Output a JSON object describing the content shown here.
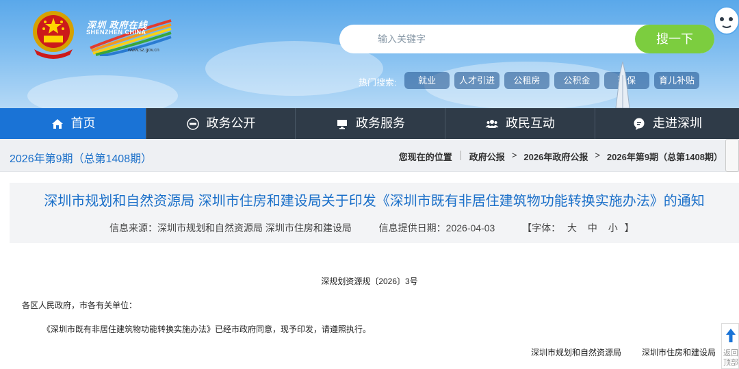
{
  "header": {
    "logo_cn": "深圳 政府在线",
    "logo_en": "SHENZHEN CHINA",
    "logo_url": "www.sz.gov.cn",
    "search": {
      "placeholder": "输入关键字",
      "button_label": "搜一下"
    },
    "hot_search": {
      "label": "热门搜索:",
      "tags": [
        "就业",
        "人才引进",
        "公租房",
        "公积金",
        "环保",
        "育儿补贴"
      ]
    }
  },
  "nav": {
    "items": [
      {
        "label": "首页",
        "icon": "home-icon",
        "active": true
      },
      {
        "label": "政务公开",
        "icon": "news-icon",
        "active": false
      },
      {
        "label": "政务服务",
        "icon": "monitor-icon",
        "active": false
      },
      {
        "label": "政民互动",
        "icon": "users-icon",
        "active": false
      },
      {
        "label": "走进深圳",
        "icon": "chat-icon",
        "active": false
      }
    ]
  },
  "breadcrumb": {
    "issue": "2026年第9期（总第1408期）",
    "location_label": "您现在的位置",
    "items": [
      "政府公报",
      "2026年政府公报",
      "2026年第9期（总第1408期）"
    ],
    "separator": ">"
  },
  "article": {
    "title": "深圳市规划和自然资源局 深圳市住房和建设局关于印发《深圳市既有非居住建筑物功能转换实施办法》的通知",
    "source_label": "信息来源：",
    "source": "深圳市规划和自然资源局 深圳市住房和建设局",
    "date_label": "信息提供日期：",
    "date": "2026-04-03",
    "font_label": "【字体：",
    "font_large": "大",
    "font_medium": "中",
    "font_small": "小",
    "font_close": "】",
    "doc_number": "深规划资源规〔2026〕3号",
    "salutation": "各区人民政府，市各有关单位：",
    "body": "《深圳市既有非居住建筑物功能转换实施办法》已经市政府同意，现予印发，请遵照执行。",
    "signatories": [
      "深圳市规划和自然资源局",
      "深圳市住房和建设局"
    ]
  },
  "back_to_top": "返回顶部",
  "colors": {
    "header_blue": "#5aa8ea",
    "nav_dark": "#2f3b48",
    "nav_active": "#1a73d6",
    "search_green": "#7ccd3f",
    "title_blue": "#1a6fc9"
  }
}
